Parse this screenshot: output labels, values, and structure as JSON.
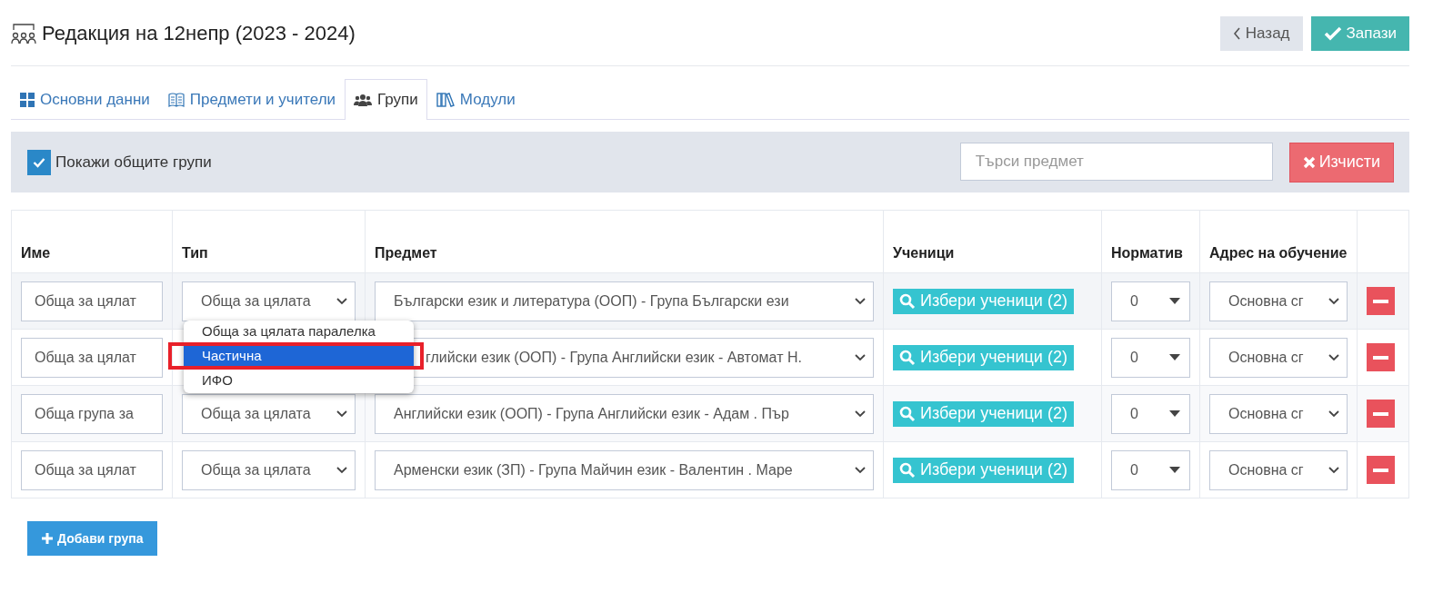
{
  "title": "Редакция на 12непр (2023 - 2024)",
  "buttons": [
    {
      "label": "Назад",
      "kind": "back"
    },
    {
      "label": "Запази",
      "kind": "save"
    }
  ],
  "tabs": [
    {
      "label": "Основни данни",
      "selected": false
    },
    {
      "label": "Предмети и учители",
      "selected": false
    },
    {
      "label": "Групи",
      "selected": true
    },
    {
      "label": "Модули",
      "selected": false
    }
  ],
  "filter": {
    "checkbox": {
      "label": "Покажи общите групи",
      "checked": true
    },
    "search": {
      "placeholder": "Търси предмет"
    },
    "clear_button": "Изчисти"
  },
  "table": {
    "columns": [
      "Име",
      "Тип",
      "Предмет",
      "Ученици",
      "Норматив",
      "Адрес на обучение"
    ],
    "rows": [
      {
        "name": "Обща за цялат",
        "type": "Обща за цялата",
        "subject": "Български език и литература (ООП) - Група Български ези",
        "students": "Избери ученици (2)",
        "norm": "0",
        "address": "Основна сг"
      },
      {
        "name": "Обща за цялат",
        "subject": "глийски език (ООП) - Група Английски език - Автомат Н.",
        "students": "Избери ученици (2)",
        "norm": "0",
        "address": "Основна сг"
      },
      {
        "name": "Обща група за",
        "type": "Обща за цялата",
        "subject": "Английски език (ООП) - Група Английски език - Адам . Пър",
        "students": "Избери ученици (2)",
        "norm": "0",
        "address": "Основна сг"
      },
      {
        "name": "Обща за цялат",
        "type": "Обща за цялата",
        "subject": "Арменски език (ЗП) - Група Майчин език - Валентин . Маре",
        "students": "Избери ученици (2)",
        "norm": "0",
        "address": "Основна сг"
      }
    ]
  },
  "type_dropdown": {
    "options": [
      {
        "label": "Обща за цялата паралелка",
        "selected": false
      },
      {
        "label": "Частична",
        "selected": true
      },
      {
        "label": "ИФО",
        "selected": false
      }
    ]
  },
  "add_button": "Добави група"
}
